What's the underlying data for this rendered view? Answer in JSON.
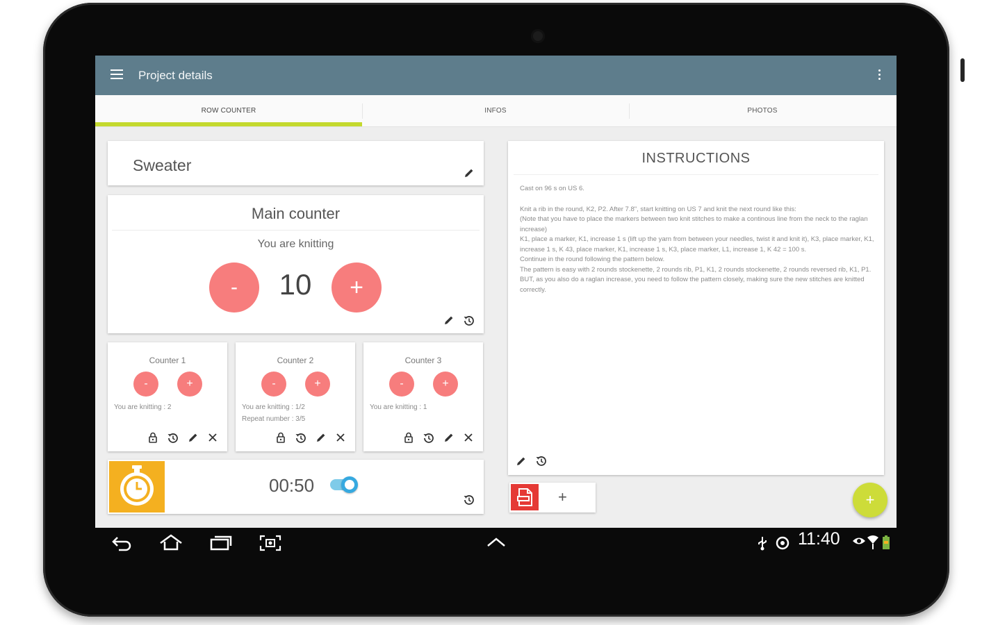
{
  "app": {
    "toolbar": {
      "title": "Project details"
    },
    "tabs": [
      {
        "label": "ROW COUNTER",
        "active": true
      },
      {
        "label": "INFOS",
        "active": false
      },
      {
        "label": "PHOTOS",
        "active": false
      }
    ],
    "accent_color": "#c4d92e",
    "toolbar_color": "#5e7d8c",
    "counter_button_color": "#f77d7d"
  },
  "project": {
    "name": "Sweater"
  },
  "main_counter": {
    "title": "Main counter",
    "subtitle": "You are knitting",
    "value": "10",
    "minus_label": "-",
    "plus_label": "+"
  },
  "counters": [
    {
      "title": "Counter 1",
      "lines": [
        "You are knitting : 2"
      ],
      "minus_label": "-",
      "plus_label": "+"
    },
    {
      "title": "Counter 2",
      "lines": [
        "You are knitting : 1/2",
        "Repeat number : 3/5"
      ],
      "minus_label": "-",
      "plus_label": "+"
    },
    {
      "title": "Counter 3",
      "lines": [
        "You are knitting : 1"
      ],
      "minus_label": "-",
      "plus_label": "+"
    }
  ],
  "timer": {
    "value": "00:50",
    "enabled": true
  },
  "instructions": {
    "title": "INSTRUCTIONS",
    "paragraphs": [
      "Cast on 96 s on US 6.",
      "",
      "Knit a rib in the round, K2, P2. After 7.8\", start knitting on US 7 and knit the next round like this:",
      "(Note that you have to place the markers between two knit stitches to make a continous line from the neck to the raglan increase)",
      "K1, place a marker, K1, increase 1 s (lift up the yarn from between your needles, twist it and knit it), K3, place marker, K1, increase 1 s, K 43, place marker, K1, increase 1 s, K3, place marker, L1, increase 1, K 42 = 100 s.",
      "Continue in the round following the pattern below.",
      "The pattern is easy with 2 rounds stockenette, 2 rounds rib, P1, K1, 2 rounds stockenette, 2 rounds reversed rib, K1, P1.",
      "BUT, as you also do a raglan increase, you need to follow the pattern closely, making sure the new stitches are knitted correctly."
    ]
  },
  "attachments": {
    "add_label": "+"
  },
  "fab": {
    "label": "+"
  },
  "system_bar": {
    "time": "11:40"
  }
}
